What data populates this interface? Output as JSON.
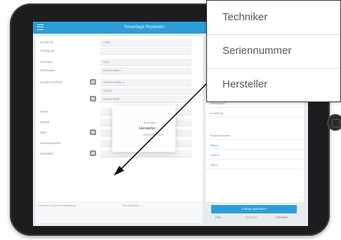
{
  "app": {
    "title": "Neuanlage Reparatur"
  },
  "form_rows": [
    {
      "label": "Kunde Nr.",
      "value": "4782"
    },
    {
      "label": "Auftrag Nr.",
      "value": ""
    },
    {
      "label": "Vorname",
      "value": "Max"
    },
    {
      "label": "Nachname",
      "value": "Mustermann"
    },
    {
      "label": "Kunde Anschrift",
      "value": "Musterstraße 1"
    },
    {
      "label": "",
      "value": "12345"
    },
    {
      "label": "",
      "value": "Musterstadt"
    },
    {
      "label": "Gerät",
      "value": ""
    },
    {
      "label": "Modell",
      "value": ""
    },
    {
      "label": "IMEI",
      "value": ""
    },
    {
      "label": "Seriennummer",
      "value": ""
    },
    {
      "label": "Hersteller",
      "value": ""
    }
  ],
  "picker": {
    "option_1": "Techniker",
    "option_2": "Hersteller",
    "option_3": "Seriennummer"
  },
  "right_panel": {
    "rows": [
      {
        "label": "Zahlungsart",
        "value": ""
      },
      {
        "label": "Anzahlung",
        "value": ""
      },
      {
        "label": "Reparaturkosten",
        "value": ""
      },
      {
        "label": "Steuer",
        "value": ""
      },
      {
        "label": "Summe",
        "value": ""
      },
      {
        "label": "Status",
        "value": ""
      }
    ]
  },
  "actions": {
    "save_label": "Auftrag speichern",
    "link_1": "Info",
    "link_2": "Vorschau",
    "link_3": "Löschen"
  },
  "notes": {
    "left": "Hinweis zur Datenverarbeitung",
    "right": "Bemerkungen"
  },
  "callout": {
    "options": [
      "Techniker",
      "Seriennummer",
      "Hersteller"
    ]
  },
  "colors": {
    "accent": "#2b9ed9",
    "danger": "#e5484d",
    "device": "#1c1c1e"
  }
}
